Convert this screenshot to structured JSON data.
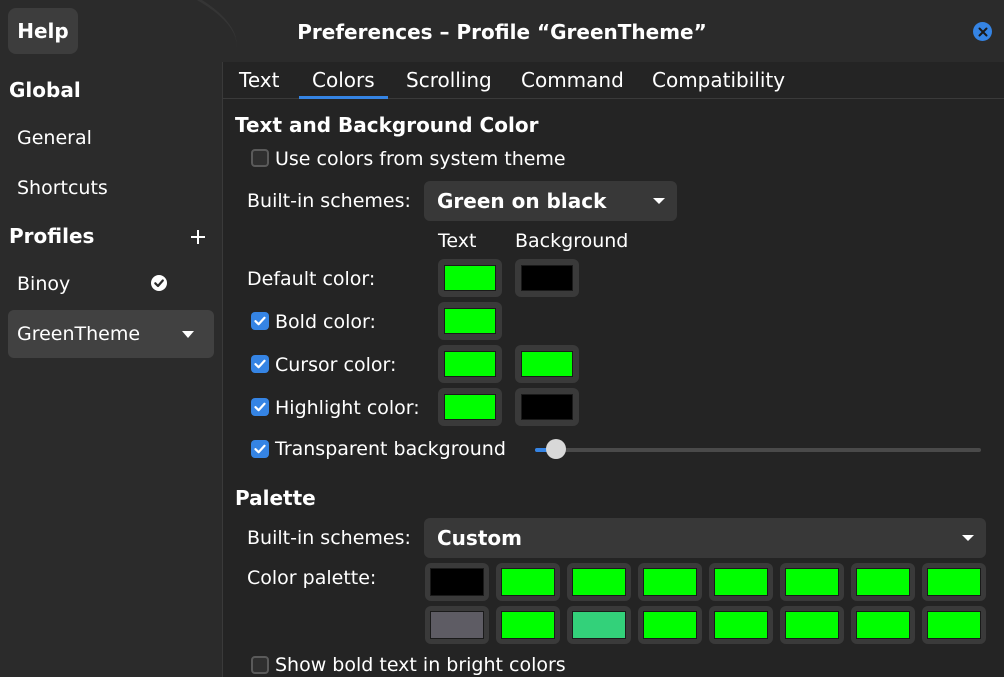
{
  "window": {
    "title": "Preferences – Profile “GreenTheme”"
  },
  "titlebar": {
    "help_label": "Help",
    "close_icon": "close-icon"
  },
  "sidebar": {
    "global_heading": "Global",
    "items": [
      {
        "label": "General"
      },
      {
        "label": "Shortcuts"
      }
    ],
    "profiles_heading": "Profiles",
    "profiles": [
      {
        "label": "Binoy",
        "icon": "default-check-icon"
      },
      {
        "label": "GreenTheme",
        "icon": "menu-arrow-icon",
        "selected": true
      }
    ]
  },
  "tabs": [
    {
      "label": "Text"
    },
    {
      "label": "Colors",
      "active": true
    },
    {
      "label": "Scrolling"
    },
    {
      "label": "Command"
    },
    {
      "label": "Compatibility"
    }
  ],
  "text_bg": {
    "title": "Text and Background Color",
    "use_system_label": "Use colors from system theme",
    "use_system_checked": false,
    "builtin_label": "Built-in schemes:",
    "builtin_value": "Green on black",
    "col_text": "Text",
    "col_background": "Background",
    "rows": [
      {
        "label": "Default color:",
        "checkbox": null,
        "text_color": "#00ff00",
        "bg_color": "#000000"
      },
      {
        "label": "Bold color:",
        "checkbox": true,
        "text_color": "#00ff00",
        "bg_color": null
      },
      {
        "label": "Cursor color:",
        "checkbox": true,
        "text_color": "#00ff00",
        "bg_color": "#00ff00"
      },
      {
        "label": "Highlight color:",
        "checkbox": true,
        "text_color": "#00ff00",
        "bg_color": "#000000"
      }
    ],
    "transparent_label": "Transparent background",
    "transparent_checked": true,
    "transparency_level": 0.05
  },
  "palette": {
    "title": "Palette",
    "builtin_label": "Built-in schemes:",
    "builtin_value": "Custom",
    "color_palette_label": "Color palette:",
    "row1": [
      "#000000",
      "#00ff00",
      "#00ff00",
      "#00ff00",
      "#00ff00",
      "#00ff00",
      "#00ff00",
      "#00ff00"
    ],
    "row2": [
      "#5e5c64",
      "#00ff00",
      "#33d17a",
      "#00ff00",
      "#00ff00",
      "#00ff00",
      "#00ff00",
      "#00ff00"
    ],
    "bold_bright_label": "Show bold text in bright colors",
    "bold_bright_checked": false
  },
  "colors": {
    "accent": "#3584e4",
    "bg": "#242424",
    "sidebar_bg": "#2b2b2b"
  }
}
